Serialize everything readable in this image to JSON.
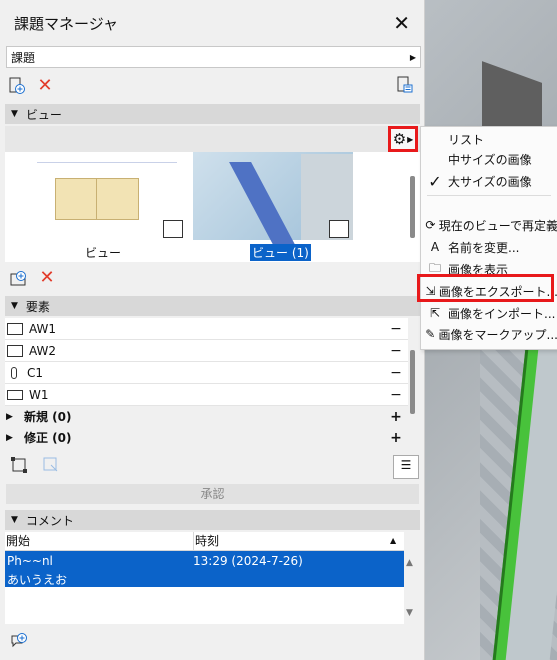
{
  "window": {
    "title": "課題マネージャ",
    "close_glyph": "✕"
  },
  "breadcrumb": {
    "value": "課題"
  },
  "sections": {
    "view": "ビュー",
    "elements": "要素",
    "comments": "コメント"
  },
  "views": [
    {
      "label": "ビュー",
      "selected": false
    },
    {
      "label": "ビュー (1)",
      "selected": true
    }
  ],
  "elements": [
    {
      "name": "AW1",
      "action": "−"
    },
    {
      "name": "AW2",
      "action": "−"
    },
    {
      "name": "C1",
      "action": "−"
    },
    {
      "name": "W1",
      "action": "−"
    }
  ],
  "groups": [
    {
      "name": "新規 (0)",
      "action": "+"
    },
    {
      "name": "修正 (0)",
      "action": "+"
    }
  ],
  "approve_label": "承認",
  "comments_table": {
    "headers": [
      "開始",
      "時刻"
    ],
    "rows": [
      {
        "author": "Ph~~nl",
        "time": "13:29 (2024-7-26)",
        "text": "あいうえお"
      }
    ]
  },
  "context_menu": {
    "items": [
      "リスト",
      "中サイズの画像",
      "大サイズの画像",
      "現在のビューで再定義",
      "名前を変更...",
      "画像を表示",
      "画像をエクスポート...",
      "画像をインポート...",
      "画像をマークアップ..."
    ],
    "checked": "大サイズの画像",
    "highlighted": "画像をエクスポート..."
  },
  "colors": {
    "accent": "#0b63c9",
    "annotation_red": "#e8191b",
    "delete_red": "#e23b2a"
  }
}
